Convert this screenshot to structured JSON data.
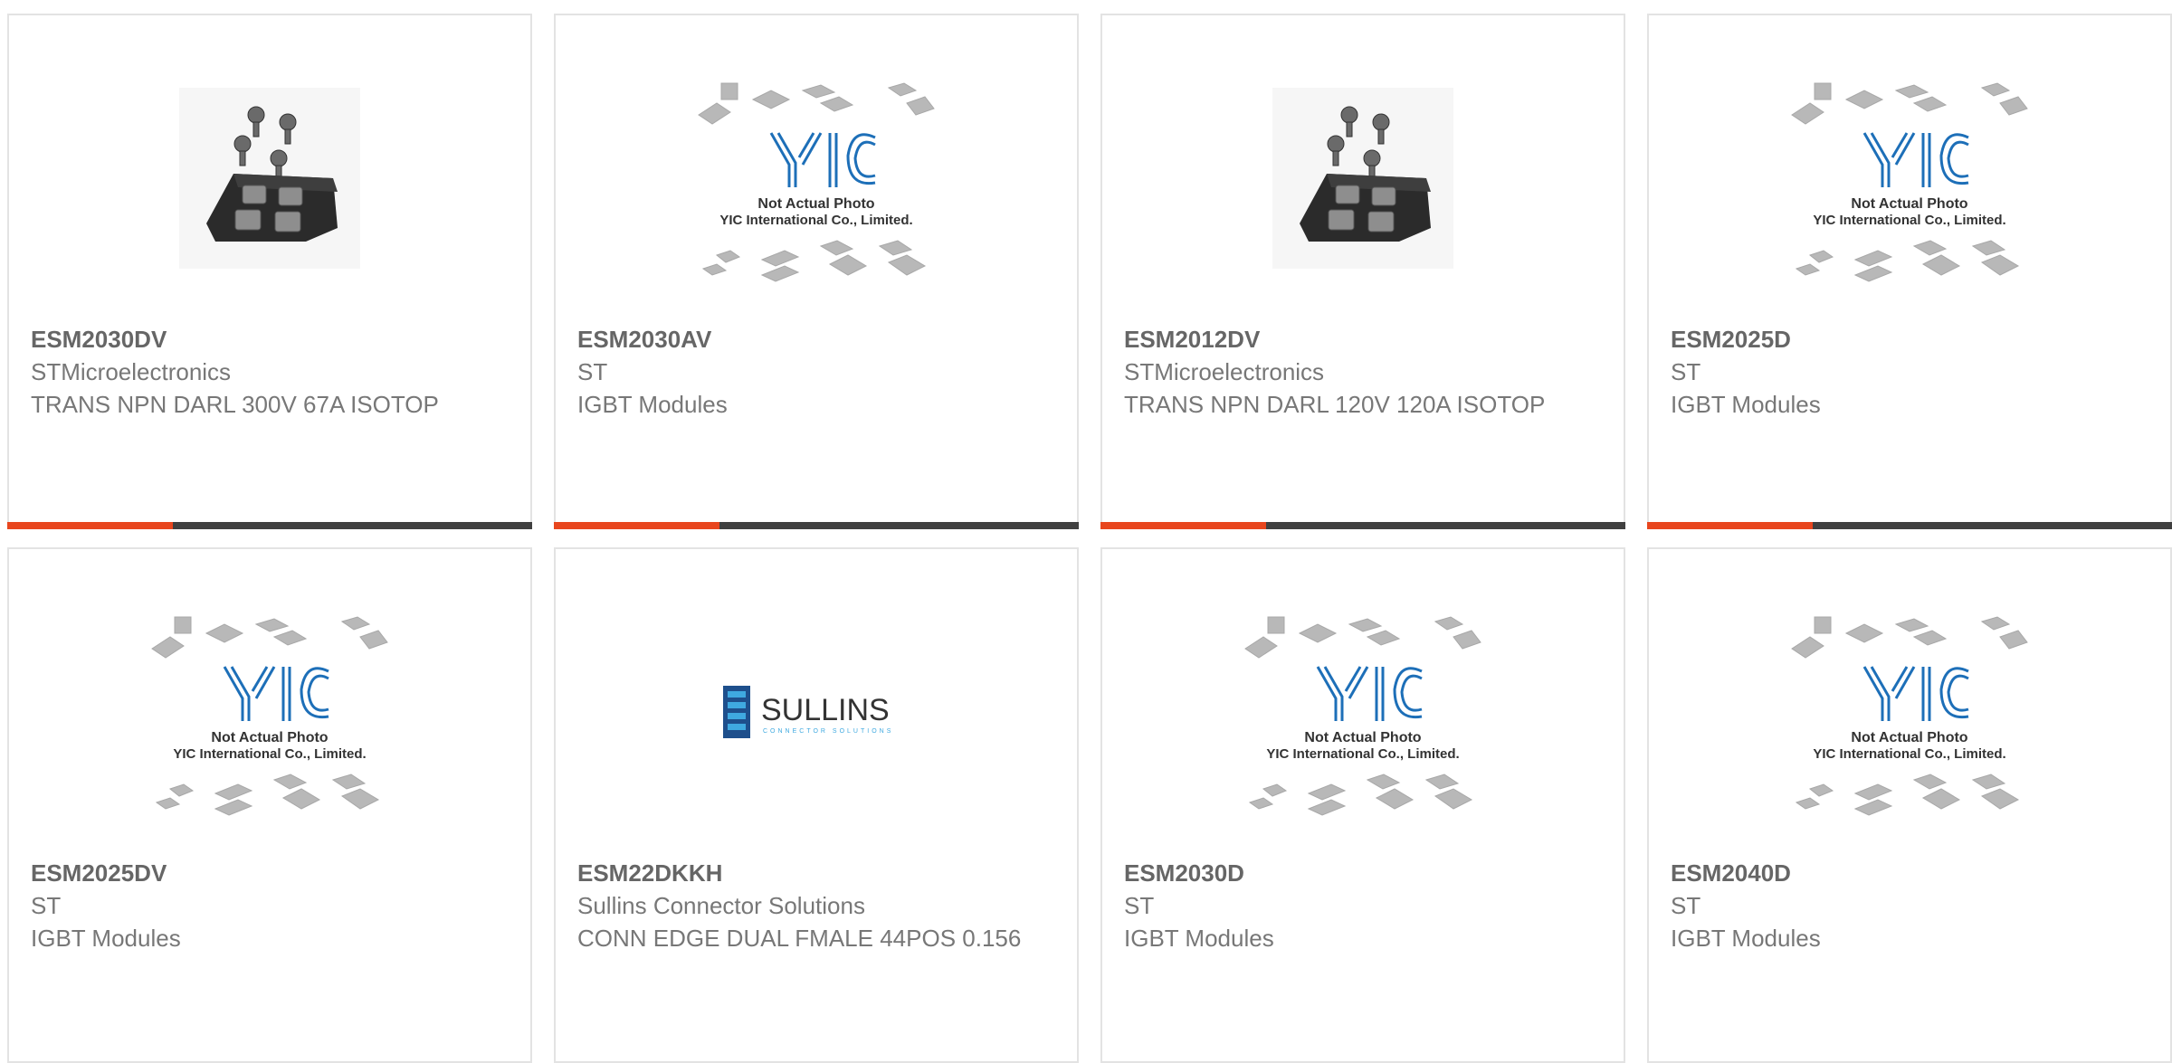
{
  "colors": {
    "accent": "#e8461e",
    "bar": "#404040",
    "yic_blue": "#1d6fb8",
    "chip_gray": "#b8b8b8",
    "sullins_blue": "#1e4f8c"
  },
  "cards": [
    {
      "part_number": "ESM2030DV",
      "manufacturer": "STMicroelectronics",
      "description": "TRANS NPN DARL 300V 67A ISOTOP",
      "image": "isotop-module-photo",
      "show_bar": true
    },
    {
      "part_number": "ESM2030AV",
      "manufacturer": "ST",
      "description": "IGBT Modules",
      "image": "yic-placeholder",
      "show_bar": true
    },
    {
      "part_number": "ESM2012DV",
      "manufacturer": "STMicroelectronics",
      "description": "TRANS NPN DARL 120V 120A ISOTOP",
      "image": "isotop-module-photo",
      "show_bar": true
    },
    {
      "part_number": "ESM2025D",
      "manufacturer": "ST",
      "description": "IGBT Modules",
      "image": "yic-placeholder",
      "show_bar": true
    },
    {
      "part_number": "ESM2025DV",
      "manufacturer": "ST",
      "description": "IGBT Modules",
      "image": "yic-placeholder",
      "show_bar": false
    },
    {
      "part_number": "ESM22DKKH",
      "manufacturer": "Sullins Connector Solutions",
      "description": "CONN EDGE DUAL FMALE 44POS 0.156",
      "image": "sullins-logo",
      "show_bar": false
    },
    {
      "part_number": "ESM2030D",
      "manufacturer": "ST",
      "description": "IGBT Modules",
      "image": "yic-placeholder",
      "show_bar": false
    },
    {
      "part_number": "ESM2040D",
      "manufacturer": "ST",
      "description": "IGBT Modules",
      "image": "yic-placeholder",
      "show_bar": false
    }
  ],
  "placeholder": {
    "brand": "YIC",
    "line1": "Not Actual Photo",
    "line2": "YIC International Co., Limited."
  },
  "sullins": {
    "wordmark": "SULLINS",
    "tagline": "CONNECTOR SOLUTIONS"
  }
}
